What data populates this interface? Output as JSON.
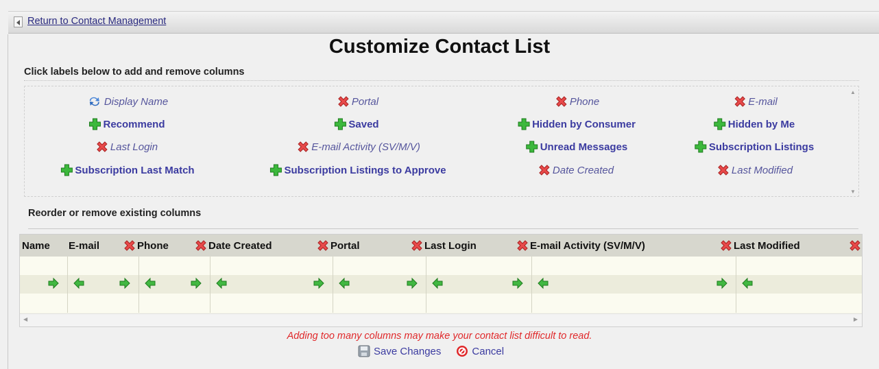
{
  "nav": {
    "back_label": "Return to Contact Management"
  },
  "title": "Customize Contact List",
  "add_section": {
    "heading": "Click labels below to add and remove columns",
    "labels": [
      {
        "text": "Display Name",
        "state": "locked",
        "icon": "refresh-icon"
      },
      {
        "text": "Portal",
        "state": "active",
        "icon": "remove-icon"
      },
      {
        "text": "Phone",
        "state": "active",
        "icon": "remove-icon"
      },
      {
        "text": "E-mail",
        "state": "active",
        "icon": "remove-icon"
      },
      {
        "text": "Recommend",
        "state": "inactive",
        "icon": "add-icon"
      },
      {
        "text": "Saved",
        "state": "inactive",
        "icon": "add-icon"
      },
      {
        "text": "Hidden by Consumer",
        "state": "inactive",
        "icon": "add-icon"
      },
      {
        "text": "Hidden by Me",
        "state": "inactive",
        "icon": "add-icon"
      },
      {
        "text": "Last Login",
        "state": "active",
        "icon": "remove-icon"
      },
      {
        "text": "E-mail Activity (SV/M/V)",
        "state": "active",
        "icon": "remove-icon"
      },
      {
        "text": "Unread Messages",
        "state": "inactive",
        "icon": "add-icon"
      },
      {
        "text": "Subscription Listings",
        "state": "inactive",
        "icon": "add-icon"
      },
      {
        "text": "Subscription Last Match",
        "state": "inactive",
        "icon": "add-icon"
      },
      {
        "text": "Subscription Listings to Approve",
        "state": "inactive",
        "icon": "add-icon"
      },
      {
        "text": "Date Created",
        "state": "active",
        "icon": "remove-icon"
      },
      {
        "text": "Last Modified",
        "state": "active",
        "icon": "remove-icon"
      }
    ]
  },
  "reorder_section": {
    "heading": "Reorder or remove existing columns",
    "columns": [
      "Name",
      "E-mail",
      "Phone",
      "Date Created",
      "Portal",
      "Last Login",
      "E-mail Activity (SV/M/V)",
      "Last Modified"
    ]
  },
  "warning": "Adding too many columns may make your contact list difficult to read.",
  "buttons": {
    "save": "Save Changes",
    "cancel": "Cancel"
  },
  "colors": {
    "add": "#2ca52c",
    "remove": "#e04848",
    "link": "#3b3ba0",
    "warning": "#e0282a"
  }
}
